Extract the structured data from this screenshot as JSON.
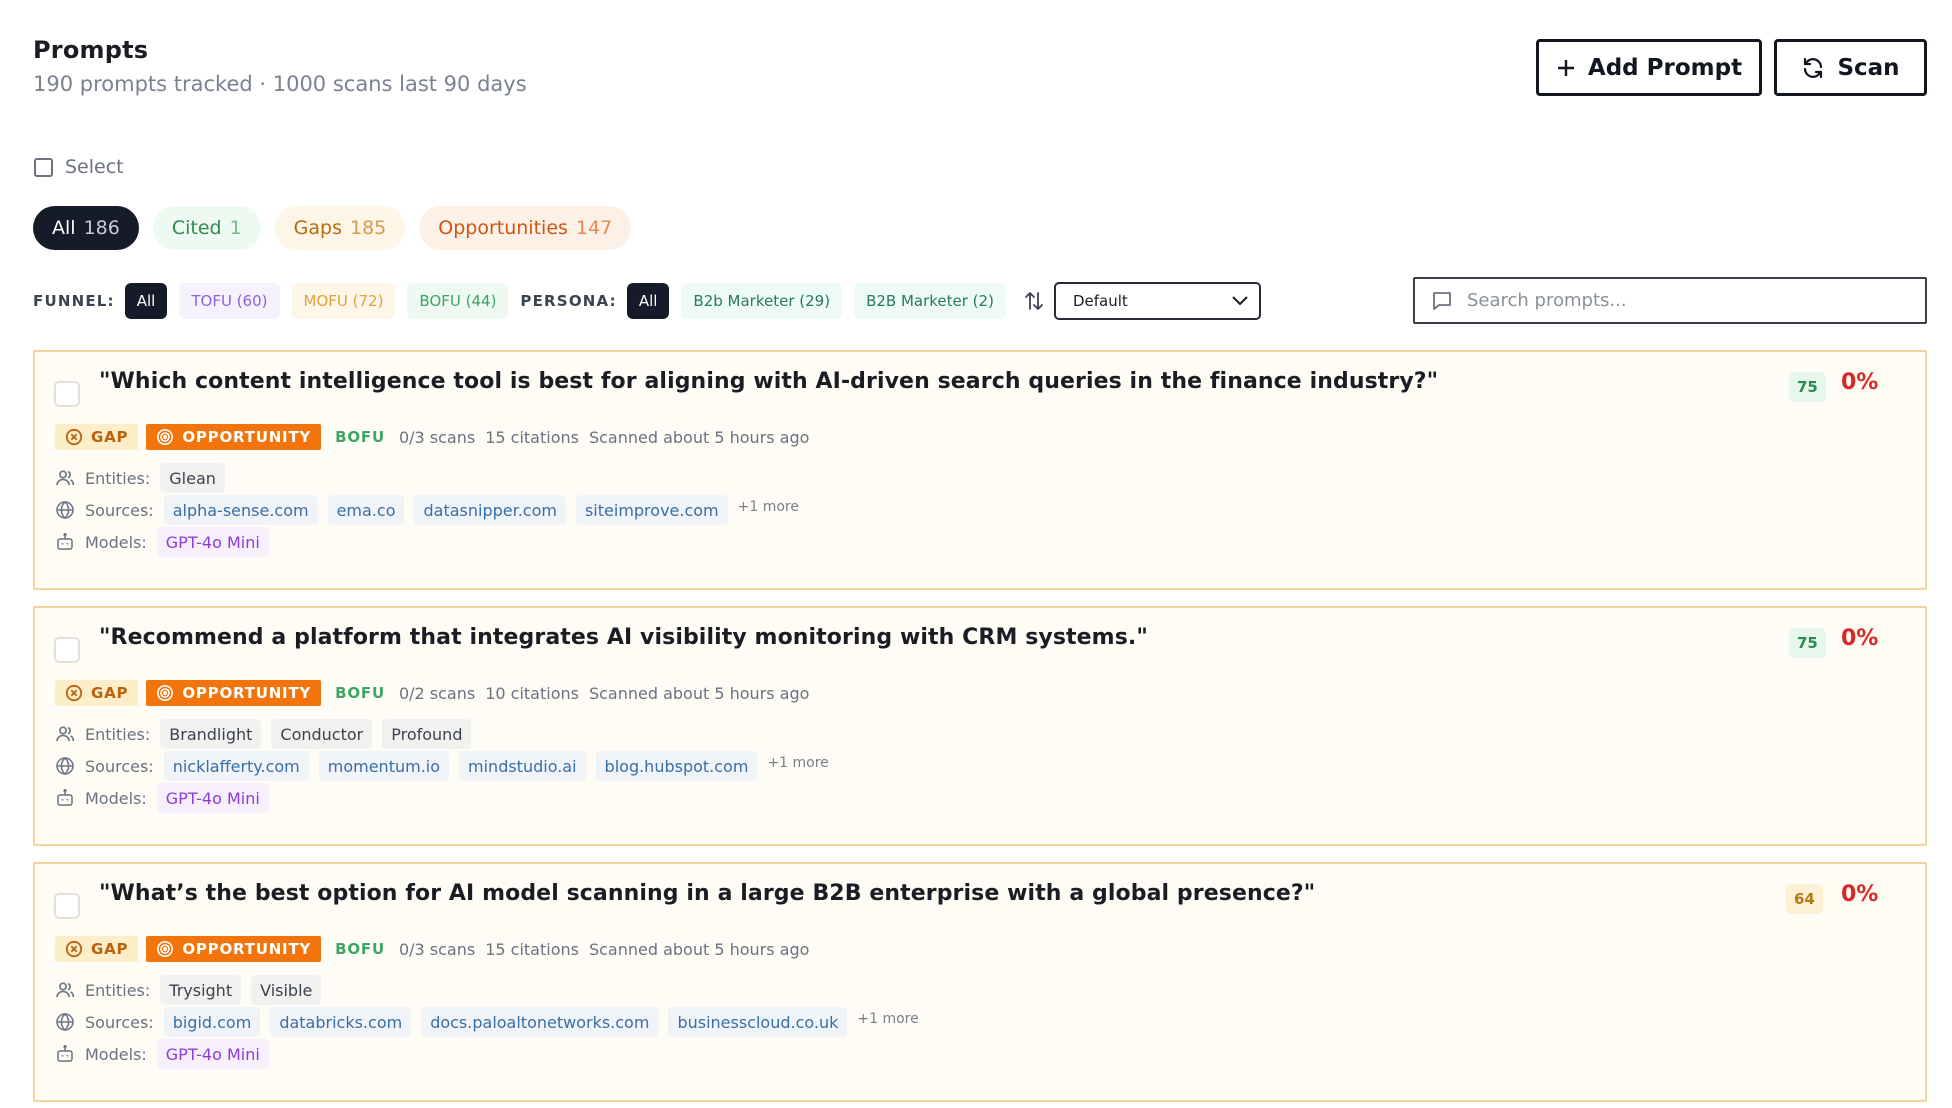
{
  "header": {
    "title": "Prompts",
    "subtitle": "190 prompts tracked · 1000 scans last 90 days",
    "add_label": "Add Prompt",
    "scan_label": "Scan"
  },
  "select_label": "Select",
  "tabs": [
    {
      "label": "All",
      "count": "186"
    },
    {
      "label": "Cited",
      "count": "1"
    },
    {
      "label": "Gaps",
      "count": "185"
    },
    {
      "label": "Opportunities",
      "count": "147"
    }
  ],
  "filters": {
    "funnel_label": "FUNNEL:",
    "funnel": [
      "All",
      "TOFU (60)",
      "MOFU (72)",
      "BOFU (44)"
    ],
    "persona_label": "PERSONA:",
    "persona": [
      "All",
      "B2b Marketer (29)",
      "B2B Marketer (2)"
    ],
    "sort_value": "Default"
  },
  "search": {
    "placeholder": "Search prompts..."
  },
  "labels": {
    "gap": "GAP",
    "opportunity": "OPPORTUNITY",
    "entities": "Entities:",
    "sources": "Sources:",
    "models": "Models:"
  },
  "prompts": [
    {
      "question": "\"Which content intelligence tool is best for aligning with AI-driven search queries in the finance industry?\"",
      "score": "75",
      "pct": "0%",
      "funnel": "BOFU",
      "scans": "0/3 scans",
      "citations": "15 citations",
      "scanned": "Scanned about 5 hours ago",
      "entities": [
        "Glean"
      ],
      "sources": [
        "alpha-sense.com",
        "ema.co",
        "datasnipper.com",
        "siteimprove.com"
      ],
      "more": "+1 more",
      "models": [
        "GPT-4o Mini"
      ]
    },
    {
      "question": "\"Recommend a platform that integrates AI visibility monitoring with CRM systems.\"",
      "score": "75",
      "pct": "0%",
      "funnel": "BOFU",
      "scans": "0/2 scans",
      "citations": "10 citations",
      "scanned": "Scanned about 5 hours ago",
      "entities": [
        "Brandlight",
        "Conductor",
        "Profound"
      ],
      "sources": [
        "nicklafferty.com",
        "momentum.io",
        "mindstudio.ai",
        "blog.hubspot.com"
      ],
      "more": "+1 more",
      "models": [
        "GPT-4o Mini"
      ]
    },
    {
      "question": "\"What’s the best option for AI model scanning in a large B2B enterprise with a global presence?\"",
      "score": "64",
      "pct": "0%",
      "funnel": "BOFU",
      "scans": "0/3 scans",
      "citations": "15 citations",
      "scanned": "Scanned about 5 hours ago",
      "entities": [
        "Trysight",
        "Visible"
      ],
      "sources": [
        "bigid.com",
        "databricks.com",
        "docs.paloaltonetworks.com",
        "businesscloud.co.uk"
      ],
      "more": "+1 more",
      "models": [
        "GPT-4o Mini"
      ]
    }
  ],
  "colors": {
    "primary": "#151b29",
    "gap_bg": "#fdeec9",
    "opportunity": "#f2740d",
    "danger": "#dc2626",
    "card_border": "#f6d29c"
  }
}
